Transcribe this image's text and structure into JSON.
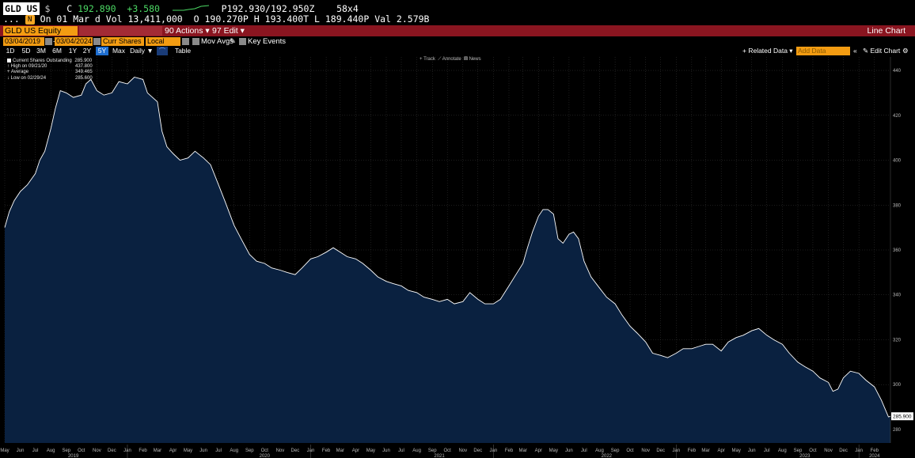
{
  "quote": {
    "ticker": "GLD US",
    "currency": "$",
    "last_label": "C",
    "last": "192.890",
    "change": "+3.580",
    "bid_ask": "P192.930/192.950Z",
    "size": "58x4",
    "lead": "...",
    "date_text": "On 01 Mar d",
    "vol_label": "Vol",
    "volume": "13,411,000",
    "open_label": "O",
    "open": "190.270P",
    "high_label": "H",
    "high": "193.400T",
    "low_label": "L",
    "low": "189.440P",
    "val_label": "Val",
    "value": "2.579B"
  },
  "menubar": {
    "security": "GLD US Equity",
    "actions": "90 Actions ▾",
    "edit": "97 Edit ▾",
    "title": "Line Chart"
  },
  "controls": {
    "start_date": "03/04/2019",
    "end_date": "03/04/2024",
    "field": "Curr Shares (",
    "currency": "Local CCY",
    "mov_avgs": "Mov Avgs",
    "key_events": "Key Events"
  },
  "periods": {
    "items": [
      "1D",
      "5D",
      "3M",
      "6M",
      "1Y",
      "2Y",
      "5Y",
      "Max"
    ],
    "selected": "5Y",
    "frequency": "Daily ▼",
    "table": "Table",
    "related": "+ Related Data ▾",
    "add_data_placeholder": "Add Data",
    "edit_chart": "✎ Edit Chart",
    "collapse": "«"
  },
  "chart_tools": {
    "track": "Track",
    "annotate": "Annotate",
    "news": "News"
  },
  "legend": {
    "title": "Current Shares Outstanding",
    "title_value": "285.900",
    "high_label": "High on 09/21/20",
    "high_value": "437.800",
    "avg_label": "Average",
    "avg_value": "349.465",
    "low_label": "Low on 02/29/24",
    "low_value": "285.600"
  },
  "colors": {
    "fill": "#0a2140",
    "line": "#ffffff",
    "grid": "#2a2a2a",
    "accent": "#f39c12",
    "menubar": "#8a1520"
  },
  "chart_data": {
    "type": "area",
    "title": "",
    "xlabel": "",
    "ylabel": "",
    "series": [
      {
        "name": "Current Shares Outstanding",
        "points": [
          [
            "2019-05-01",
            370
          ],
          [
            "2019-05-10",
            377
          ],
          [
            "2019-05-20",
            382
          ],
          [
            "2019-06-01",
            386
          ],
          [
            "2019-06-15",
            389
          ],
          [
            "2019-07-01",
            394
          ],
          [
            "2019-07-10",
            400
          ],
          [
            "2019-07-20",
            404
          ],
          [
            "2019-08-01",
            414
          ],
          [
            "2019-08-10",
            423
          ],
          [
            "2019-08-20",
            431
          ],
          [
            "2019-09-01",
            430
          ],
          [
            "2019-09-15",
            428
          ],
          [
            "2019-10-01",
            429
          ],
          [
            "2019-10-10",
            434
          ],
          [
            "2019-10-20",
            436
          ],
          [
            "2019-11-01",
            431
          ],
          [
            "2019-11-15",
            429
          ],
          [
            "2019-12-01",
            430
          ],
          [
            "2019-12-15",
            435
          ],
          [
            "2020-01-01",
            434
          ],
          [
            "2020-01-15",
            437
          ],
          [
            "2020-02-01",
            436
          ],
          [
            "2020-02-10",
            430
          ],
          [
            "2020-02-20",
            428
          ],
          [
            "2020-03-01",
            426
          ],
          [
            "2020-03-10",
            413
          ],
          [
            "2020-03-20",
            406
          ],
          [
            "2020-04-01",
            403
          ],
          [
            "2020-04-15",
            400
          ],
          [
            "2020-05-01",
            401
          ],
          [
            "2020-05-15",
            404
          ],
          [
            "2020-06-01",
            401
          ],
          [
            "2020-06-15",
            398
          ],
          [
            "2020-07-01",
            389
          ],
          [
            "2020-07-15",
            381
          ],
          [
            "2020-08-01",
            371
          ],
          [
            "2020-08-15",
            365
          ],
          [
            "2020-09-01",
            358
          ],
          [
            "2020-09-15",
            355
          ],
          [
            "2020-10-01",
            354
          ],
          [
            "2020-10-15",
            352
          ],
          [
            "2020-11-01",
            351
          ],
          [
            "2020-11-15",
            350
          ],
          [
            "2020-12-01",
            349
          ],
          [
            "2020-12-15",
            352
          ],
          [
            "2021-01-01",
            356
          ],
          [
            "2021-01-15",
            357
          ],
          [
            "2021-02-01",
            359
          ],
          [
            "2021-02-15",
            361
          ],
          [
            "2021-03-01",
            359
          ],
          [
            "2021-03-15",
            357
          ],
          [
            "2021-04-01",
            356
          ],
          [
            "2021-04-15",
            354
          ],
          [
            "2021-05-01",
            351
          ],
          [
            "2021-05-15",
            348
          ],
          [
            "2021-06-01",
            346
          ],
          [
            "2021-06-15",
            345
          ],
          [
            "2021-07-01",
            344
          ],
          [
            "2021-07-15",
            342
          ],
          [
            "2021-08-01",
            341
          ],
          [
            "2021-08-15",
            339
          ],
          [
            "2021-09-01",
            338
          ],
          [
            "2021-09-15",
            337
          ],
          [
            "2021-10-01",
            338
          ],
          [
            "2021-10-15",
            336
          ],
          [
            "2021-11-01",
            337
          ],
          [
            "2021-11-15",
            341
          ],
          [
            "2021-12-01",
            338
          ],
          [
            "2021-12-15",
            336
          ],
          [
            "2022-01-01",
            336
          ],
          [
            "2022-01-15",
            338
          ],
          [
            "2022-02-01",
            344
          ],
          [
            "2022-02-15",
            349
          ],
          [
            "2022-03-01",
            354
          ],
          [
            "2022-03-10",
            361
          ],
          [
            "2022-03-20",
            368
          ],
          [
            "2022-04-01",
            375
          ],
          [
            "2022-04-10",
            378
          ],
          [
            "2022-04-20",
            378
          ],
          [
            "2022-05-01",
            376
          ],
          [
            "2022-05-10",
            365
          ],
          [
            "2022-05-20",
            363
          ],
          [
            "2022-06-01",
            367
          ],
          [
            "2022-06-10",
            368
          ],
          [
            "2022-06-20",
            365
          ],
          [
            "2022-07-01",
            355
          ],
          [
            "2022-07-15",
            348
          ],
          [
            "2022-08-01",
            343
          ],
          [
            "2022-08-15",
            339
          ],
          [
            "2022-09-01",
            336
          ],
          [
            "2022-09-15",
            331
          ],
          [
            "2022-10-01",
            326
          ],
          [
            "2022-10-15",
            323
          ],
          [
            "2022-11-01",
            319
          ],
          [
            "2022-11-15",
            314
          ],
          [
            "2022-12-01",
            313
          ],
          [
            "2022-12-15",
            312
          ],
          [
            "2023-01-01",
            314
          ],
          [
            "2023-01-15",
            316
          ],
          [
            "2023-02-01",
            316
          ],
          [
            "2023-02-15",
            317
          ],
          [
            "2023-03-01",
            318
          ],
          [
            "2023-03-15",
            318
          ],
          [
            "2023-04-01",
            315
          ],
          [
            "2023-04-15",
            319
          ],
          [
            "2023-05-01",
            321
          ],
          [
            "2023-05-15",
            322
          ],
          [
            "2023-06-01",
            324
          ],
          [
            "2023-06-15",
            325
          ],
          [
            "2023-07-01",
            322
          ],
          [
            "2023-07-15",
            320
          ],
          [
            "2023-08-01",
            318
          ],
          [
            "2023-08-15",
            314
          ],
          [
            "2023-09-01",
            310
          ],
          [
            "2023-09-15",
            308
          ],
          [
            "2023-10-01",
            306
          ],
          [
            "2023-10-15",
            303
          ],
          [
            "2023-11-01",
            301
          ],
          [
            "2023-11-10",
            297
          ],
          [
            "2023-11-20",
            298
          ],
          [
            "2023-12-01",
            303
          ],
          [
            "2023-12-15",
            306
          ],
          [
            "2024-01-01",
            305
          ],
          [
            "2024-01-15",
            302
          ],
          [
            "2024-02-01",
            299
          ],
          [
            "2024-02-15",
            293
          ],
          [
            "2024-02-29",
            285.6
          ],
          [
            "2024-03-04",
            285.9
          ]
        ]
      }
    ],
    "y_ticks": [
      280,
      300,
      320,
      340,
      360,
      380,
      400,
      420,
      440
    ],
    "ylim": [
      274,
      446
    ],
    "xlim": [
      "2019-05-01",
      "2024-03-04"
    ],
    "last_value_label": "285.900",
    "month_labels": [
      [
        "2019-05-01",
        "May"
      ],
      [
        "2019-06-01",
        "Jun"
      ],
      [
        "2019-07-01",
        "Jul"
      ],
      [
        "2019-08-01",
        "Aug"
      ],
      [
        "2019-09-01",
        "Sep"
      ],
      [
        "2019-10-01",
        "Oct"
      ],
      [
        "2019-11-01",
        "Nov"
      ],
      [
        "2019-12-01",
        "Dec"
      ],
      [
        "2020-01-01",
        "Jan"
      ],
      [
        "2020-02-01",
        "Feb"
      ],
      [
        "2020-03-01",
        "Mar"
      ],
      [
        "2020-04-01",
        "Apr"
      ],
      [
        "2020-05-01",
        "May"
      ],
      [
        "2020-06-01",
        "Jun"
      ],
      [
        "2020-07-01",
        "Jul"
      ],
      [
        "2020-08-01",
        "Aug"
      ],
      [
        "2020-09-01",
        "Sep"
      ],
      [
        "2020-10-01",
        "Oct"
      ],
      [
        "2020-11-01",
        "Nov"
      ],
      [
        "2020-12-01",
        "Dec"
      ],
      [
        "2021-01-01",
        "Jan"
      ],
      [
        "2021-02-01",
        "Feb"
      ],
      [
        "2021-03-01",
        "Mar"
      ],
      [
        "2021-04-01",
        "Apr"
      ],
      [
        "2021-05-01",
        "May"
      ],
      [
        "2021-06-01",
        "Jun"
      ],
      [
        "2021-07-01",
        "Jul"
      ],
      [
        "2021-08-01",
        "Aug"
      ],
      [
        "2021-09-01",
        "Sep"
      ],
      [
        "2021-10-01",
        "Oct"
      ],
      [
        "2021-11-01",
        "Nov"
      ],
      [
        "2021-12-01",
        "Dec"
      ],
      [
        "2022-01-01",
        "Jan"
      ],
      [
        "2022-02-01",
        "Feb"
      ],
      [
        "2022-03-01",
        "Mar"
      ],
      [
        "2022-04-01",
        "Apr"
      ],
      [
        "2022-05-01",
        "May"
      ],
      [
        "2022-06-01",
        "Jun"
      ],
      [
        "2022-07-01",
        "Jul"
      ],
      [
        "2022-08-01",
        "Aug"
      ],
      [
        "2022-09-01",
        "Sep"
      ],
      [
        "2022-10-01",
        "Oct"
      ],
      [
        "2022-11-01",
        "Nov"
      ],
      [
        "2022-12-01",
        "Dec"
      ],
      [
        "2023-01-01",
        "Jan"
      ],
      [
        "2023-02-01",
        "Feb"
      ],
      [
        "2023-03-01",
        "Mar"
      ],
      [
        "2023-04-01",
        "Apr"
      ],
      [
        "2023-05-01",
        "May"
      ],
      [
        "2023-06-01",
        "Jun"
      ],
      [
        "2023-07-01",
        "Jul"
      ],
      [
        "2023-08-01",
        "Aug"
      ],
      [
        "2023-09-01",
        "Sep"
      ],
      [
        "2023-10-01",
        "Oct"
      ],
      [
        "2023-11-01",
        "Nov"
      ],
      [
        "2023-12-01",
        "Dec"
      ],
      [
        "2024-01-01",
        "Jan"
      ],
      [
        "2024-02-01",
        "Feb"
      ]
    ],
    "year_labels": [
      [
        "2019-09-15",
        "2019"
      ],
      [
        "2020-10-01",
        "2020"
      ],
      [
        "2021-09-15",
        "2021"
      ],
      [
        "2022-08-15",
        "2022"
      ],
      [
        "2023-09-15",
        "2023"
      ],
      [
        "2024-02-01",
        "2024"
      ]
    ],
    "grid": true,
    "legend_position": "top-left"
  }
}
